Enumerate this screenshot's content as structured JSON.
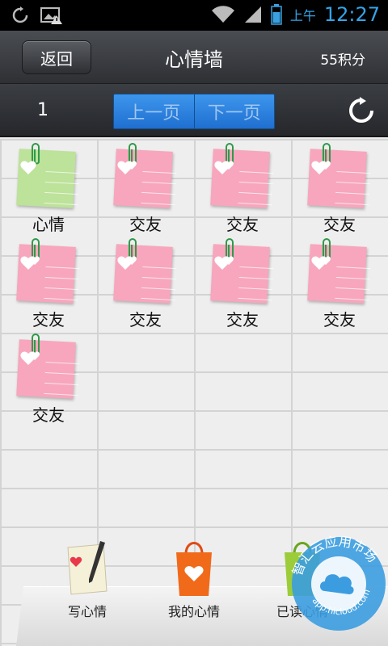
{
  "status_bar": {
    "ampm": "上午",
    "time": "12:27"
  },
  "header": {
    "back_label": "返回",
    "title": "心情墙",
    "points": "55积分"
  },
  "pager": {
    "page_number": "1",
    "prev_label": "上一页",
    "next_label": "下一页"
  },
  "notes": [
    {
      "label": "心情",
      "color": "#bde29a"
    },
    {
      "label": "交友",
      "color": "#f7a6bd"
    },
    {
      "label": "交友",
      "color": "#f7a6bd"
    },
    {
      "label": "交友",
      "color": "#f7a6bd"
    },
    {
      "label": "交友",
      "color": "#f7a6bd"
    },
    {
      "label": "交友",
      "color": "#f7a6bd"
    },
    {
      "label": "交友",
      "color": "#f7a6bd"
    },
    {
      "label": "交友",
      "color": "#f7a6bd"
    },
    {
      "label": "交友",
      "color": "#f7a6bd"
    }
  ],
  "toolbar": {
    "write_label": "写心情",
    "mine_label": "我的心情",
    "third_label": "已读心情"
  },
  "watermark": {
    "text_top": "智汇云应用市场",
    "text_bottom": "app.hicloud.com"
  }
}
